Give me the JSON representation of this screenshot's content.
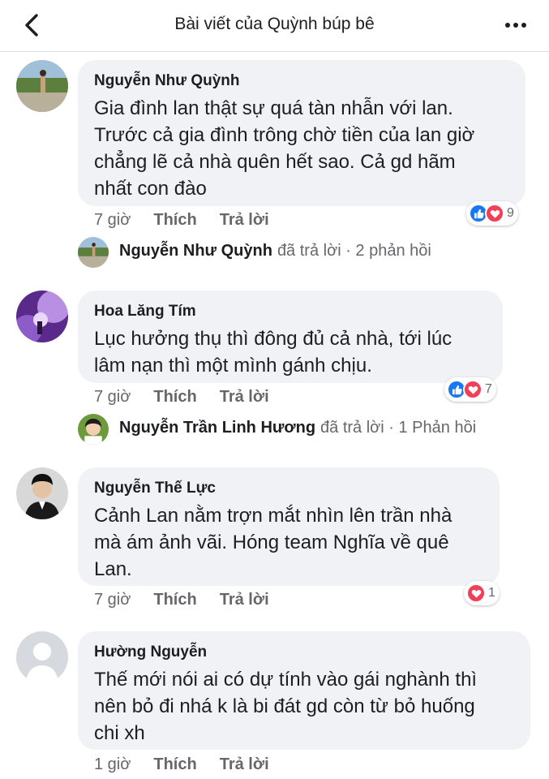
{
  "header": {
    "title": "Bài viết của Quỳnh búp bê"
  },
  "comments": [
    {
      "author": "Nguyễn Như Quỳnh",
      "lines": [
        "Gia đình lan thật sự quá tàn nhẫn với lan.",
        "Trước cả gia đình trông chờ tiền của lan giờ",
        "chẳng lẽ cả nhà quên hết sao. Cả gd hãm",
        "nhất con đào"
      ],
      "time": "7 giờ",
      "like_label": "Thích",
      "reply_label": "Trả lời",
      "reaction_count": "9",
      "reply_summary": {
        "name": "Nguyễn Như Quỳnh",
        "text": "đã trả lời · 2 phản hồi"
      }
    },
    {
      "author": "Hoa Lăng Tím",
      "lines": [
        "Lục hưởng thụ thì đông đủ cả nhà, tới lúc",
        "lâm nạn thì một mình gánh chịu."
      ],
      "time": "7 giờ",
      "like_label": "Thích",
      "reply_label": "Trả lời",
      "reaction_count": "7",
      "reply_summary": {
        "name": "Nguyễn Trần Linh Hương",
        "text": "đã trả lời · 1 Phản hồi"
      }
    },
    {
      "author": "Nguyễn Thế Lực",
      "lines": [
        "Cảnh Lan nằm trợn mắt nhìn lên trần nhà",
        "mà ám ảnh vãi. Hóng team Nghĩa về quê",
        "Lan."
      ],
      "time": "7 giờ",
      "like_label": "Thích",
      "reply_label": "Trả lời",
      "reaction_count": "1"
    },
    {
      "author": "Hường Nguyễn",
      "lines": [
        "Thế mới nói ai có dự tính vào gái nghành thì",
        "nên bỏ đi nhá k là bi đát gd còn từ bỏ huống",
        "chi xh"
      ],
      "time": "1 giờ",
      "like_label": "Thích",
      "reply_label": "Trả lời"
    }
  ],
  "colors": {
    "bubble": "#f0f2f5",
    "like": "#1877f2",
    "love": "#f33e58",
    "meta_text": "#65676b"
  }
}
